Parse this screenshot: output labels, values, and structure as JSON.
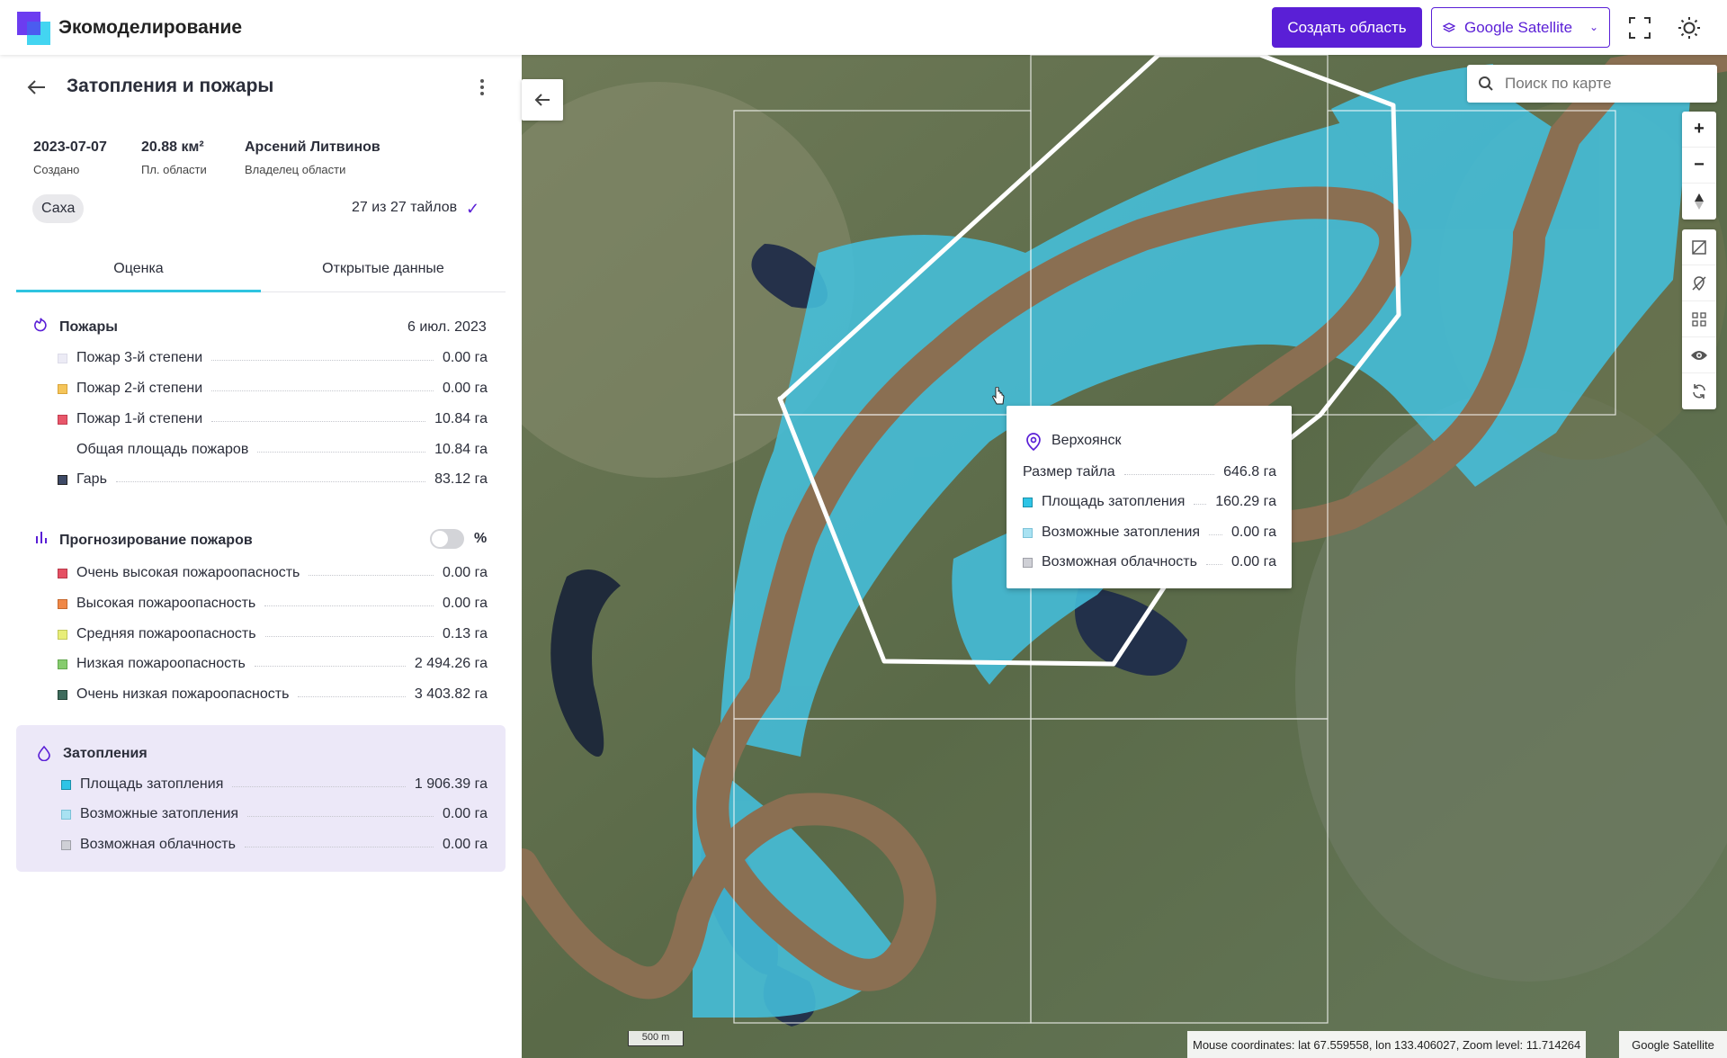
{
  "app": {
    "title": "Экомоделирование"
  },
  "header": {
    "create_button": "Создать область",
    "layer_select": "Google Satellite"
  },
  "area": {
    "title": "Затопления и пожары",
    "created_value": "2023-07-07",
    "created_label": "Создано",
    "square_value": "20.88 км²",
    "square_label": "Пл. области",
    "owner_value": "Арсений Литвинов",
    "owner_label": "Владелец области",
    "region_chip": "Саха",
    "tiles_status": "27 из 27 тайлов"
  },
  "tabs": [
    {
      "label": "Оценка",
      "active": true
    },
    {
      "label": "Открытые данные",
      "active": false
    }
  ],
  "fires": {
    "title": "Пожары",
    "date": "6 июл. 2023",
    "items": [
      {
        "name": "Пожар 3-й степени",
        "value": "0.00 га",
        "color": "#ecebf5"
      },
      {
        "name": "Пожар 2-й степени",
        "value": "0.00 га",
        "color": "#f5c55a"
      },
      {
        "name": "Пожар 1-й степени",
        "value": "10.84 га",
        "color": "#e8576a"
      },
      {
        "name": "Общая площадь пожаров",
        "value": "10.84 га",
        "color": ""
      },
      {
        "name": "Гарь",
        "value": "83.12 га",
        "color": "#3e4a66"
      }
    ]
  },
  "forecast": {
    "title": "Прогнозирование пожаров",
    "toggle_label": "%",
    "items": [
      {
        "name": "Очень высокая пожароопасность",
        "value": "0.00 га",
        "color": "#e55063"
      },
      {
        "name": "Высокая пожароопасность",
        "value": "0.00 га",
        "color": "#f08848"
      },
      {
        "name": "Средняя пожароопасность",
        "value": "0.13 га",
        "color": "#e8ee78"
      },
      {
        "name": "Низкая пожароопасность",
        "value": "2 494.26 га",
        "color": "#86cc6e"
      },
      {
        "name": "Очень низкая пожароопасность",
        "value": "3 403.82 га",
        "color": "#3d6b5c"
      }
    ]
  },
  "floods": {
    "title": "Затопления",
    "items": [
      {
        "name": "Площадь затопления",
        "value": "1 906.39 га",
        "color": "#2ec4e6"
      },
      {
        "name": "Возможные затопления",
        "value": "0.00 га",
        "color": "#a9e2f2"
      },
      {
        "name": "Возможная облачность",
        "value": "0.00 га",
        "color": "#cfd0d6"
      }
    ]
  },
  "map": {
    "search_placeholder": "Поиск по карте",
    "scale": "500 m",
    "coords": "Mouse coordinates: lat 67.559558, lon 133.406027, Zoom level: 11.714264",
    "attribution": "Google Satellite",
    "tooltip": {
      "title": "Верхоянск",
      "tile_size_label": "Размер тайла",
      "tile_size_value": "646.8 га",
      "items": [
        {
          "name": "Площадь затопления",
          "value": "160.29 га",
          "color": "#2ec4e6"
        },
        {
          "name": "Возможные затопления",
          "value": "0.00 га",
          "color": "#a9e2f2"
        },
        {
          "name": "Возможная облачность",
          "value": "0.00 га",
          "color": "#cfd0d6"
        }
      ]
    }
  }
}
